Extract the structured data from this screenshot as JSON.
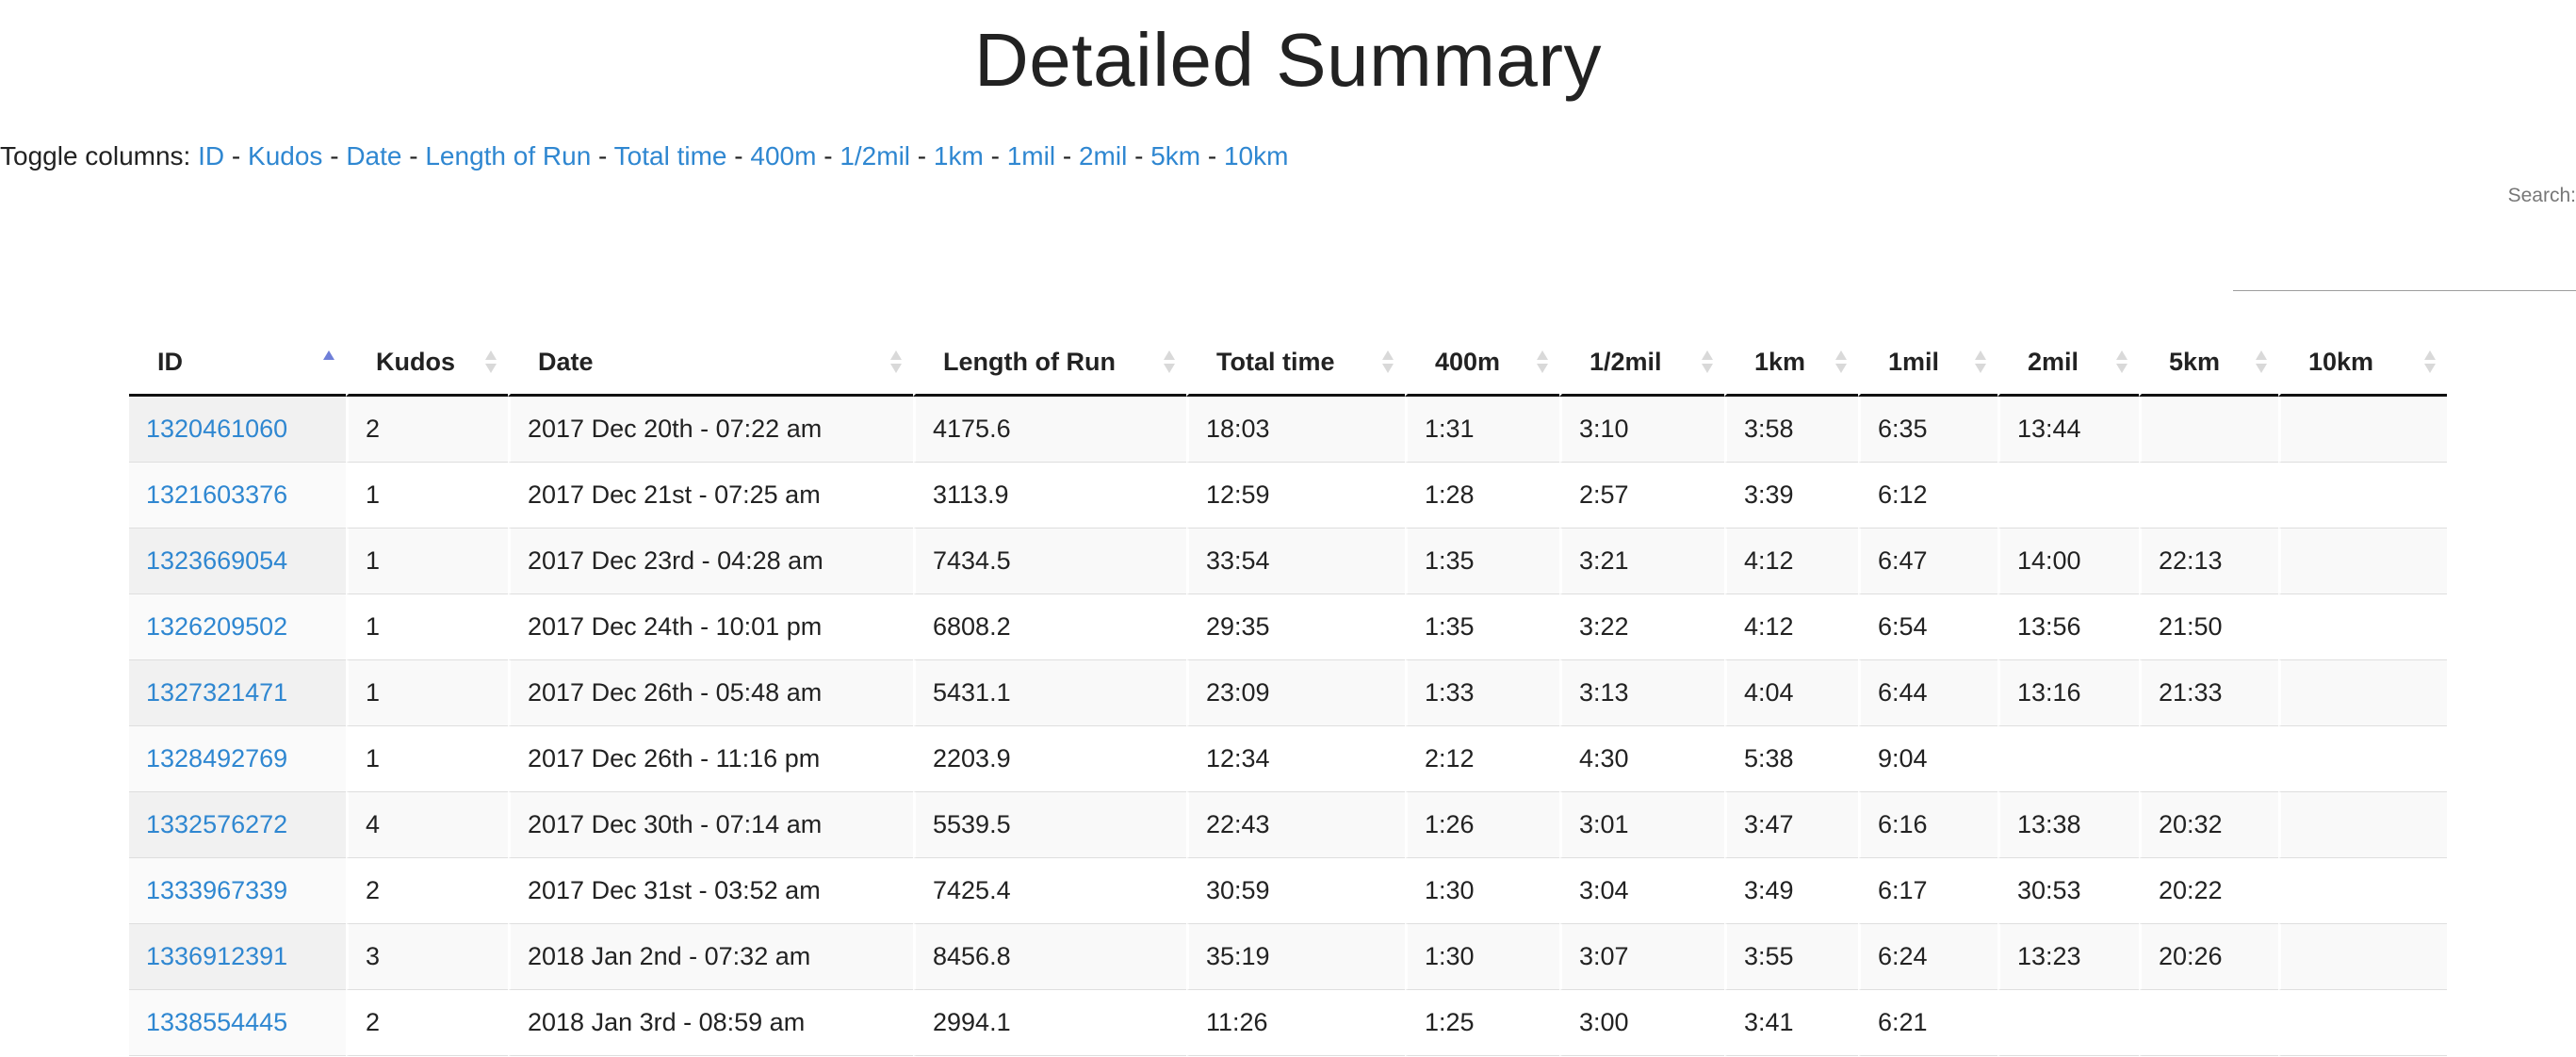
{
  "page": {
    "title": "Detailed Summary"
  },
  "toggle": {
    "label": "Toggle columns:",
    "columns": [
      "ID",
      "Kudos",
      "Date",
      "Length of Run",
      "Total time",
      "400m",
      "1/2mil",
      "1km",
      "1mil",
      "2mil",
      "5km",
      "10km"
    ]
  },
  "search": {
    "label": "Search:",
    "value": ""
  },
  "table": {
    "headers": [
      "ID",
      "Kudos",
      "Date",
      "Length of Run",
      "Total time",
      "400m",
      "1/2mil",
      "1km",
      "1mil",
      "2mil",
      "5km",
      "10km"
    ],
    "sorted_column": "ID",
    "sort_direction": "ascending",
    "rows": [
      [
        "1320461060",
        "2",
        "2017 Dec 20th - 07:22 am",
        "4175.6",
        "18:03",
        "1:31",
        "3:10",
        "3:58",
        "6:35",
        "13:44",
        "",
        ""
      ],
      [
        "1321603376",
        "1",
        "2017 Dec 21st - 07:25 am",
        "3113.9",
        "12:59",
        "1:28",
        "2:57",
        "3:39",
        "6:12",
        "",
        "",
        ""
      ],
      [
        "1323669054",
        "1",
        "2017 Dec 23rd - 04:28 am",
        "7434.5",
        "33:54",
        "1:35",
        "3:21",
        "4:12",
        "6:47",
        "14:00",
        "22:13",
        ""
      ],
      [
        "1326209502",
        "1",
        "2017 Dec 24th - 10:01 pm",
        "6808.2",
        "29:35",
        "1:35",
        "3:22",
        "4:12",
        "6:54",
        "13:56",
        "21:50",
        ""
      ],
      [
        "1327321471",
        "1",
        "2017 Dec 26th - 05:48 am",
        "5431.1",
        "23:09",
        "1:33",
        "3:13",
        "4:04",
        "6:44",
        "13:16",
        "21:33",
        ""
      ],
      [
        "1328492769",
        "1",
        "2017 Dec 26th - 11:16 pm",
        "2203.9",
        "12:34",
        "2:12",
        "4:30",
        "5:38",
        "9:04",
        "",
        "",
        ""
      ],
      [
        "1332576272",
        "4",
        "2017 Dec 30th - 07:14 am",
        "5539.5",
        "22:43",
        "1:26",
        "3:01",
        "3:47",
        "6:16",
        "13:38",
        "20:32",
        ""
      ],
      [
        "1333967339",
        "2",
        "2017 Dec 31st - 03:52 am",
        "7425.4",
        "30:59",
        "1:30",
        "3:04",
        "3:49",
        "6:17",
        "30:53",
        "20:22",
        ""
      ],
      [
        "1336912391",
        "3",
        "2018 Jan 2nd - 07:32 am",
        "8456.8",
        "35:19",
        "1:30",
        "3:07",
        "3:55",
        "6:24",
        "13:23",
        "20:26",
        ""
      ],
      [
        "1338554445",
        "2",
        "2018 Jan 3rd - 08:59 am",
        "2994.1",
        "11:26",
        "1:25",
        "3:00",
        "3:41",
        "6:21",
        "",
        "",
        ""
      ]
    ]
  },
  "colors": {
    "link": "#2f87d1",
    "sort_active": "#6f7fd8",
    "sort_inactive": "#d9d9d9",
    "row_stripe": "#f9f9f9"
  }
}
